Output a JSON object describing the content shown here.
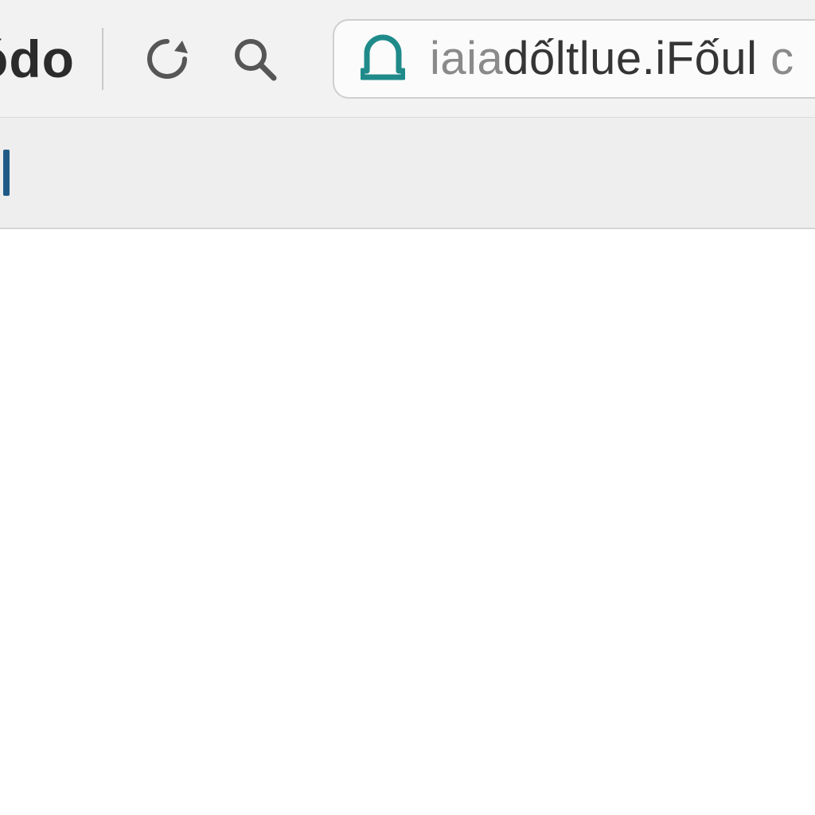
{
  "toolbar": {
    "title": "ódo",
    "refresh_name": "refresh",
    "search_name": "search"
  },
  "addressbar": {
    "site_icon_name": "bell-arch-icon",
    "url_prefix_dim": "iaia",
    "url_mid": "dốltlue.iFốul ",
    "url_suffix_dim": "c"
  },
  "colors": {
    "toolbar_bg": "#f2f2f2",
    "subbar_bg": "#eeeeee",
    "border": "#d6d6d6",
    "icon": "#565656",
    "site_icon": "#1f8a8a",
    "submark": "#1f5a86",
    "url_bright": "#353535",
    "url_dim": "#8a8a8a"
  }
}
